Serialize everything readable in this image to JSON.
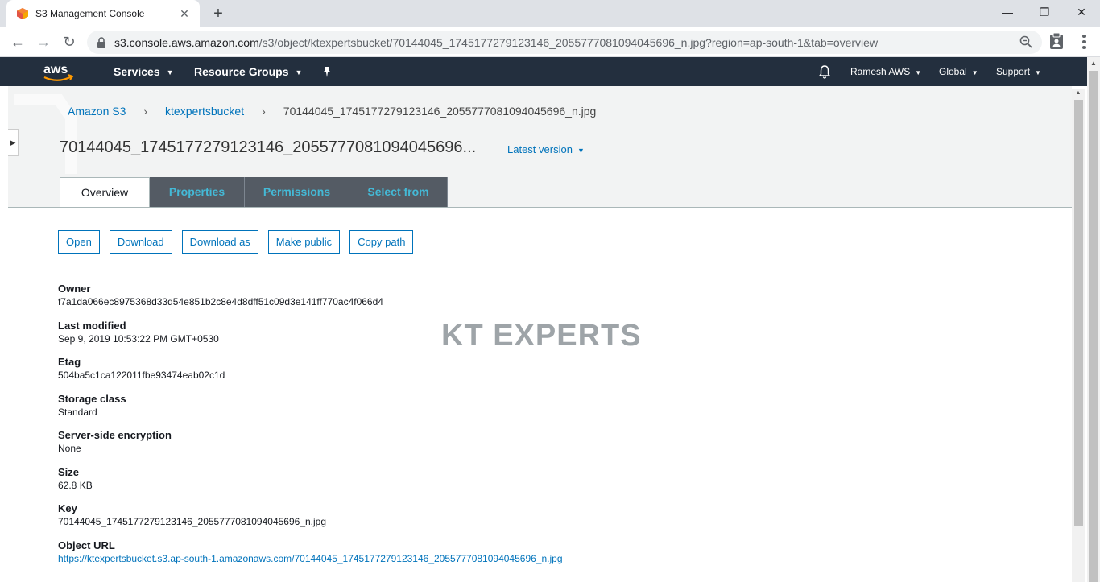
{
  "browser": {
    "tab_title": "S3 Management Console",
    "url_host": "s3.console.aws.amazon.com",
    "url_rest": "/s3/object/ktexpertsbucket/70144045_1745177279123146_2055777081094045696_n.jpg?region=ap-south-1&tab=overview"
  },
  "awsnav": {
    "services": "Services",
    "resource_groups": "Resource Groups",
    "user": "Ramesh AWS",
    "region": "Global",
    "support": "Support"
  },
  "breadcrumb": {
    "root": "Amazon S3",
    "bucket": "ktexpertsbucket",
    "current": "70144045_1745177279123146_2055777081094045696_n.jpg"
  },
  "page": {
    "title": "70144045_1745177279123146_2055777081094045696...",
    "version": "Latest version"
  },
  "tabs": [
    {
      "label": "Overview",
      "active": true
    },
    {
      "label": "Properties",
      "active": false
    },
    {
      "label": "Permissions",
      "active": false
    },
    {
      "label": "Select from",
      "active": false
    }
  ],
  "actions": {
    "open": "Open",
    "download": "Download",
    "download_as": "Download as",
    "make_public": "Make public",
    "copy_path": "Copy path"
  },
  "details": [
    {
      "label": "Owner",
      "value": "f7a1da066ec8975368d33d54e851b2c8e4d8dff51c09d3e141ff770ac4f066d4"
    },
    {
      "label": "Last modified",
      "value": "Sep 9, 2019 10:53:22 PM GMT+0530"
    },
    {
      "label": "Etag",
      "value": "504ba5c1ca122011fbe93474eab02c1d"
    },
    {
      "label": "Storage class",
      "value": "Standard"
    },
    {
      "label": "Server-side encryption",
      "value": "None"
    },
    {
      "label": "Size",
      "value": "62.8 KB"
    },
    {
      "label": "Key",
      "value": "70144045_1745177279123146_2055777081094045696_n.jpg"
    },
    {
      "label": "Object URL",
      "value": "https://ktexpertsbucket.s3.ap-south-1.amazonaws.com/70144045_1745177279123146_2055777081094045696_n.jpg"
    }
  ],
  "watermark": "KT EXPERTS",
  "colors": {
    "aws_nav": "#232f3e",
    "link": "#0073bb",
    "tab_bg": "#545b64",
    "tab_text": "#44b9d6",
    "aws_orange": "#ff9900"
  }
}
